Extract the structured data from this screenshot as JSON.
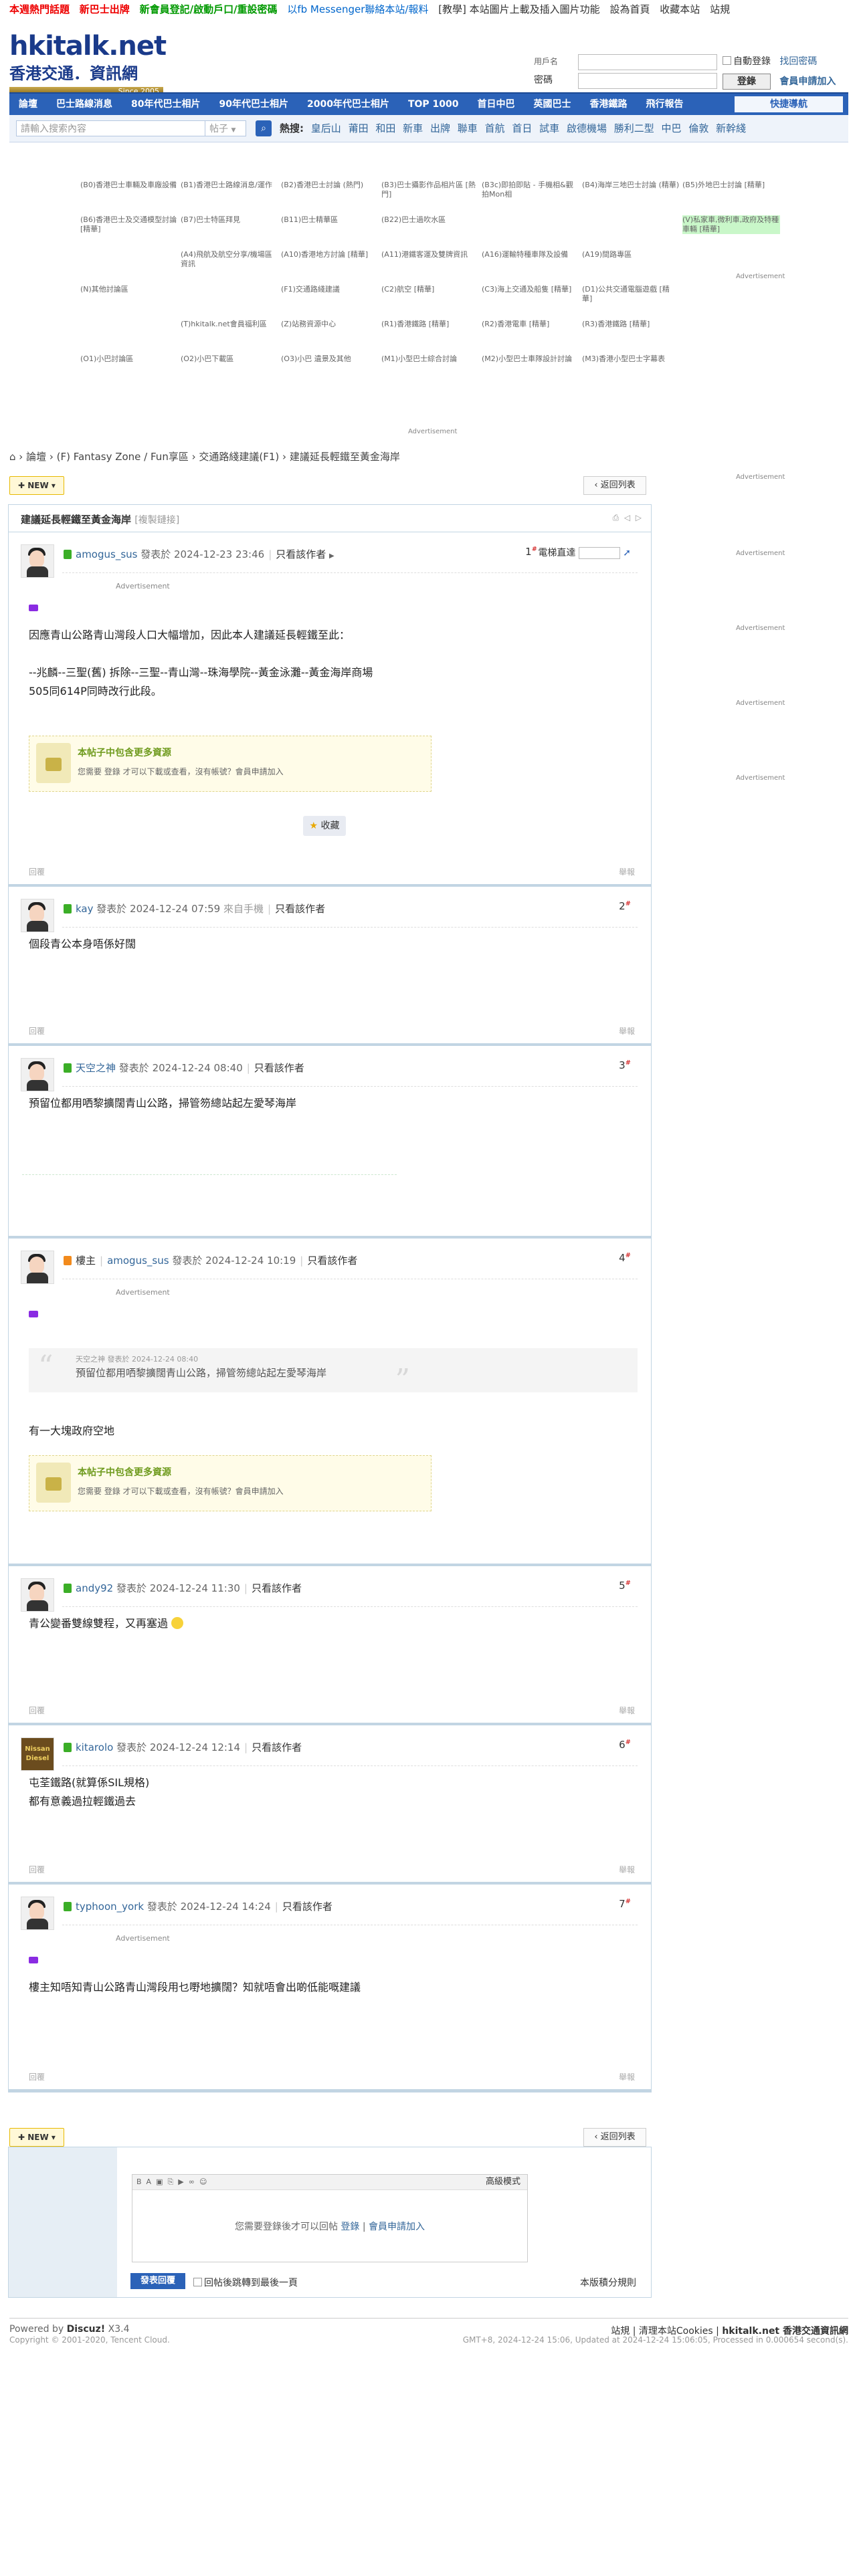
{
  "topbar": [
    {
      "text": "本週熱門話題",
      "style": "red"
    },
    {
      "text": "新巴士出牌",
      "style": "red"
    },
    {
      "text": "新會員登記/啟動戶口/重設密碼",
      "style": "green"
    },
    {
      "text": "以fb Messenger聯絡本站/報料",
      "style": "blue"
    },
    {
      "text": "[教學] 本站圖片上載及插入圖片功能",
      "style": "plain"
    },
    {
      "text": "設為首頁",
      "style": "plain"
    },
    {
      "text": "收藏本站",
      "style": "plain"
    },
    {
      "text": "站規",
      "style": "plain"
    }
  ],
  "logo": {
    "line1": "hkitalk.net",
    "line2": "香港交通．資訊網",
    "since": "Since 2005"
  },
  "login": {
    "username_label": "用戶名",
    "password_label": "密碼",
    "auto_login": "自動登錄",
    "forgot": "找回密碼",
    "login_button": "登錄",
    "register": "會員申請加入"
  },
  "nav": {
    "items": [
      "論壇",
      "巴士路線消息",
      "80年代巴士相片",
      "90年代巴士相片",
      "2000年代巴士相片",
      "TOP 1000",
      "首日中巴",
      "英國巴士",
      "香港鐵路",
      "飛行報告"
    ],
    "quick": "快捷導航"
  },
  "search": {
    "placeholder": "請輸入搜索內容",
    "type": "帖子",
    "hot_label": "熱搜:",
    "hot": [
      "皇后山",
      "莆田",
      "和田",
      "新車",
      "出牌",
      "聯車",
      "首航",
      "首日",
      "試車",
      "啟德機場",
      "勝利二型",
      "中巴",
      "倫敦",
      "新幹綫"
    ]
  },
  "links": [
    "(B0)香港巴士車輛及車廠設備",
    "(B1)香港巴士路線消息/運作",
    "(B2)香港巴士討論 (熱門)",
    "(B3)巴士攝影作品相片區 [熱門]",
    "(B3c)即拍即貼 - 手機相&觀拍Mon相",
    "(B4)海岸三地巴士討論 (精華)",
    "(B5)外地巴士討論 [精華]",
    "(B6)香港巴士及交通模型討論 [精華]",
    "(B7)巴士特區拜見",
    "(B11)巴士精華區",
    "(B22)巴士過吹水區",
    "",
    "",
    "(V)私家車,微利車,政府及特種車輛 [精華]",
    "",
    "(A4)飛航及航空分享/機場區資訊",
    "(A10)香港地方討論 [精華]",
    "(A11)港鐵客運及雙牌資訊",
    "(A16)運輸特種車隊及設備",
    "(A19)間路專區",
    "",
    "(N)其他討論區",
    "",
    "(F1)交通路綫建議",
    "(C2)航空 [精華]",
    "(C3)海上交通及船隻 [精華]",
    "(D1)公共交通電腦遊戲 [精華]",
    "",
    "",
    "(T)hkitalk.net會員福利區",
    "(Z)站務資源中心",
    "(R1)香港鐵路 [精華]",
    "(R2)香港電車 [精華]",
    "(R3)香港鐵路 [精華]",
    "",
    "(O1)小巴討論區",
    "(O2)小巴下載區",
    "(O3)小巴 遺景及其他",
    "(M1)小型巴士綜合討論",
    "(M2)小型巴士車隊設計討論",
    "(M3)香港小型巴士字幕表",
    "",
    "",
    "",
    ""
  ],
  "highlight_index": 13,
  "advert_label": "Advertisement",
  "breadcrumb": [
    "論壇",
    "(F) Fantasy Zone / Fun享區",
    "交通路綫建議(F1)",
    "建議延長輕鐵至黃金海岸"
  ],
  "new_button": "NEW",
  "back_button": "返回列表",
  "thread": {
    "title": "建議延長輕鐵至黃金海岸",
    "copy_link": "[複製鏈接]"
  },
  "only_author": "只看該作者",
  "jump_label": "電梯直達",
  "reply_label": "回覆",
  "report_label": "舉報",
  "fav_label": "收藏",
  "locked": {
    "title": "本帖子中包含更多資源",
    "body": "您需要 登錄 才可以下載或查看，沒有帳號？會員申請加入"
  },
  "posts": [
    {
      "author": "amogus_sus",
      "date": "發表於 2024-12-23 23:46",
      "num": "1",
      "lines": [
        "因應青山公路青山灣段人口大幅增加，因此本人建議延長輕鐵至此：",
        "",
        "--兆麟--三聖(舊) 拆除--三聖--青山灣--珠海學院--黃金泳灘--黃金海岸商場",
        "505同614P同時改行此段。"
      ],
      "avatar": "person"
    },
    {
      "author": "kay",
      "date": "發表於 2024-12-24 07:59",
      "mobile": "來自手機",
      "num": "2",
      "lines": [
        "個段青公本身唔係好闊"
      ],
      "avatar": "person"
    },
    {
      "author": "天空之神",
      "date": "發表於 2024-12-24 08:40",
      "num": "3",
      "lines": [
        "預留位都用哂黎擴闊青山公路，掃管笏總站起左愛琴海岸"
      ],
      "avatar": "person"
    },
    {
      "author": "amogus_sus",
      "date": "發表於 2024-12-24 10:19",
      "num": "4",
      "owner": "樓主",
      "quote_head": "天空之神 發表於 2024-12-24 08:40",
      "quote_body": "預留位都用哂黎擴闊青山公路，掃管笏總站起左愛琴海岸",
      "lines": [
        "有一大塊政府空地"
      ],
      "avatar": "person"
    },
    {
      "author": "andy92",
      "date": "發表於 2024-12-24 11:30",
      "num": "5",
      "lines": [
        "青公變番雙線雙程，又再塞過"
      ],
      "avatar": "person"
    },
    {
      "author": "kitarolo",
      "date": "發表於 2024-12-24 12:14",
      "num": "6",
      "lines": [
        "屯荃鐵路(就算係SIL規格)",
        "都有意義過拉輕鐵過去"
      ],
      "avatar": "brown",
      "avatar_text": "Nissan Diesel"
    },
    {
      "author": "typhoon_york",
      "date": "發表於 2024-12-24 14:24",
      "num": "7",
      "lines": [
        "樓主知唔知青山公路青山灣段用乜嘢地擴闊？知就唔會出啲低能嘅建議"
      ],
      "avatar": "person"
    }
  ],
  "reply": {
    "advanced": "高級模式",
    "need_login": "您需要登錄後才可以回帖",
    "login": "登錄",
    "register": "會員申請加入",
    "send": "發表回覆",
    "back_to_last": "回帖後跳轉到最後一頁",
    "rules": "本版積分規則"
  },
  "footer": {
    "powered": "Powered by",
    "discuz": "Discuz!",
    "version": "X3.4",
    "copyright": "Copyright © 2001-2020, Tencent Cloud.",
    "links": [
      "站規",
      "清理本站Cookies",
      "hkitalk.net 香港交通資訊網"
    ],
    "stats": "GMT+8, 2024-12-24 15:06, Updated at 2024-12-24 15:06:05, Processed in 0.000654 second(s)."
  }
}
